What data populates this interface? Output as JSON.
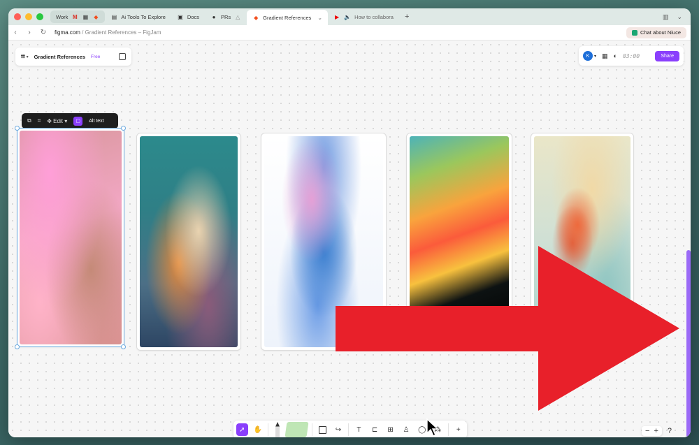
{
  "browser": {
    "tabs": [
      {
        "label": "Work",
        "icon": "workspace-icon"
      },
      {
        "label": "",
        "icon": "gmail-icon"
      },
      {
        "label": "",
        "icon": "calendar-icon"
      },
      {
        "label": "",
        "icon": "figma-icon"
      },
      {
        "label": "Ai Tools To Explore",
        "icon": "notion-icon"
      },
      {
        "label": "Docs",
        "icon": "docs-icon"
      },
      {
        "label": "PRs",
        "icon": "github-icon"
      },
      {
        "label": "Gradient References",
        "icon": "figma-icon",
        "active": true
      },
      {
        "label": "How to collabora",
        "icon": "youtube-icon"
      }
    ],
    "url_host": "figma.com",
    "url_path": " / Gradient References – FigJam",
    "chat_button": "Chat about Niuce"
  },
  "file": {
    "name": "Gradient References",
    "badge": "Free"
  },
  "header_right": {
    "avatar_initial": "K",
    "timer": "03:00",
    "share_label": "Share"
  },
  "image_toolbar": {
    "edit_label": "Edit",
    "alt_text_label": "Alt text"
  },
  "colors": {
    "accent": "#8a3ffc",
    "selection": "#6aa8de",
    "arrow": "#e8202a"
  },
  "zoom": {
    "minus": "−",
    "plus": "+",
    "help": "?"
  }
}
